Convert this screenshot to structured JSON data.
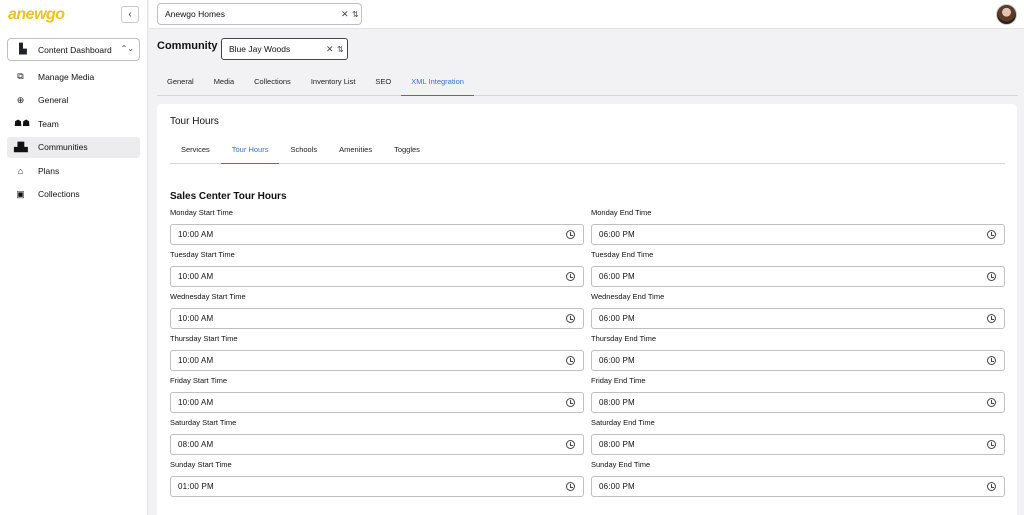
{
  "sidebar": {
    "logo": "anewgo",
    "collapse_icon": "‹",
    "dashboard_select": {
      "label": "Content Dashboard",
      "icon": "building-icon"
    },
    "items": [
      {
        "label": "Manage Media",
        "icon": "media-icon",
        "glyph": "🗇"
      },
      {
        "label": "General",
        "icon": "globe-icon",
        "glyph": "🌐"
      },
      {
        "label": "Team",
        "icon": "team-icon",
        "glyph": "👥"
      },
      {
        "label": "Communities",
        "icon": "communities-icon",
        "glyph": "🏘"
      },
      {
        "label": "Plans",
        "icon": "home-icon",
        "glyph": "⌂"
      },
      {
        "label": "Collections",
        "icon": "collections-icon",
        "glyph": "▣"
      }
    ],
    "active_item": "Communities"
  },
  "topbar": {
    "builder_value": "Anewgo Homes"
  },
  "community": {
    "label": "Community",
    "value": "Blue Jay Woods"
  },
  "main_tabs": [
    "General",
    "Media",
    "Collections",
    "Inventory List",
    "SEO",
    "XML Integration"
  ],
  "main_tab_active": "XML Integration",
  "card": {
    "title": "Tour Hours",
    "sub_tabs": [
      "Services",
      "Tour Hours",
      "Schools",
      "Amenities",
      "Toggles"
    ],
    "sub_tab_active": "Tour Hours",
    "section_title": "Sales Center Tour Hours",
    "rows": [
      {
        "start_label": "Monday Start Time",
        "start_value": "10:00 AM",
        "end_label": "Monday End Time",
        "end_value": "06:00 PM"
      },
      {
        "start_label": "Tuesday Start Time",
        "start_value": "10:00 AM",
        "end_label": "Tuesday End Time",
        "end_value": "06:00 PM"
      },
      {
        "start_label": "Wednesday Start Time",
        "start_value": "10:00 AM",
        "end_label": "Wednesday End Time",
        "end_value": "06:00 PM"
      },
      {
        "start_label": "Thursday Start Time",
        "start_value": "10:00 AM",
        "end_label": "Thursday End Time",
        "end_value": "06:00 PM"
      },
      {
        "start_label": "Friday Start Time",
        "start_value": "10:00 AM",
        "end_label": "Friday End Time",
        "end_value": "08:00 PM"
      },
      {
        "start_label": "Saturday Start Time",
        "start_value": "08:00 AM",
        "end_label": "Saturday End Time",
        "end_value": "08:00 PM"
      },
      {
        "start_label": "Sunday Start Time",
        "start_value": "01:00 PM",
        "end_label": "Sunday End Time",
        "end_value": "06:00 PM"
      }
    ]
  },
  "colors": {
    "accent": "#3b6fd6",
    "logo": "#f2c21b"
  }
}
